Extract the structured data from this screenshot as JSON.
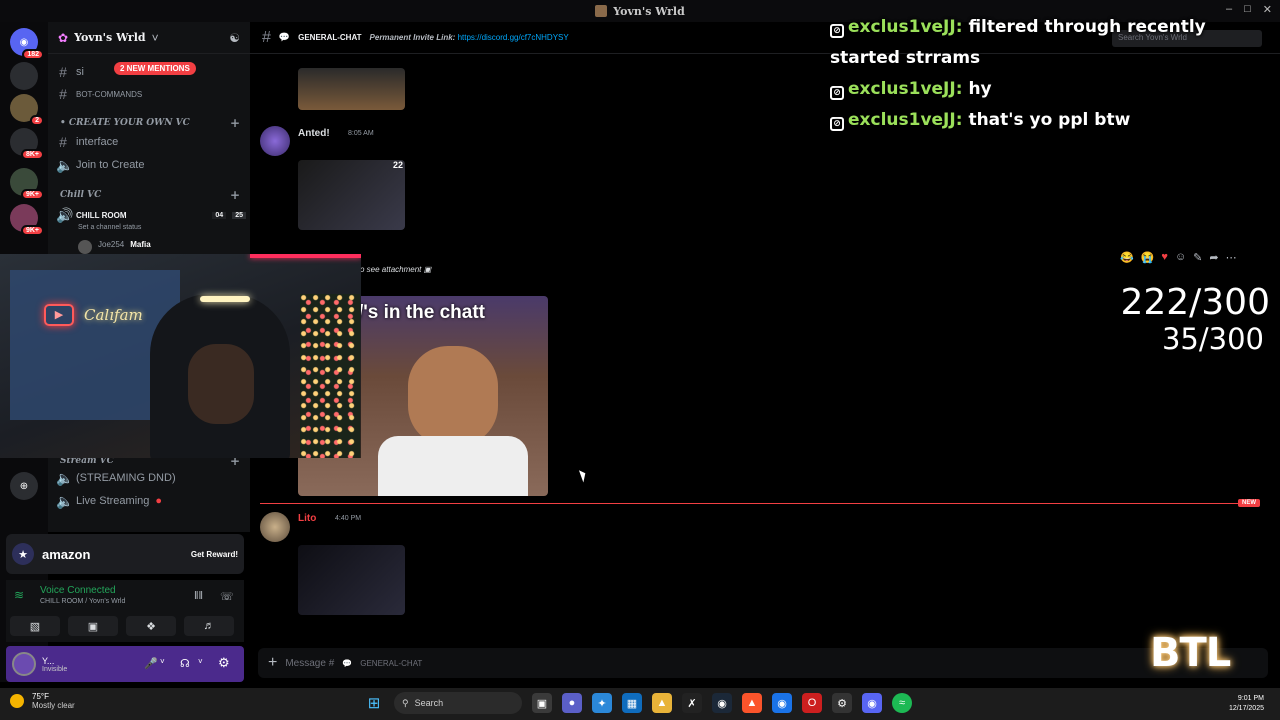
{
  "window": {
    "title": "Yovn's Wrld",
    "controls": [
      "–",
      "□",
      "✕"
    ]
  },
  "server_rail": {
    "badges": [
      "182",
      "2",
      "8K+",
      "9K+",
      "9K+"
    ]
  },
  "sidebar": {
    "server_name": "Yovn's Wrld",
    "mentions_pill": "2 NEW MENTIONS",
    "channels": [
      {
        "name": "si",
        "type": "text"
      },
      {
        "name": "BOT-COMMANDS",
        "type": "text"
      },
      {
        "name": "interface",
        "type": "text"
      },
      {
        "name": "Join to Create",
        "type": "voice"
      },
      {
        "name": "(STREAMING DND)",
        "type": "voice"
      },
      {
        "name": "Live Streaming",
        "type": "voice"
      }
    ],
    "categories": [
      "CREATE YOUR OWN VC",
      "Chill VC",
      "Stream VC"
    ],
    "chill_room": {
      "name": "CHILL ROOM",
      "counts": [
        "04",
        "25"
      ],
      "status": "Set a channel status"
    },
    "voice_member": {
      "name": "Joe254",
      "tag": "Mafia"
    }
  },
  "promo": {
    "brand": "amazon",
    "cta": "Get Reward!"
  },
  "voice": {
    "status": "Voice Connected",
    "location": "CHILL ROOM / Yovn's Wrld"
  },
  "user": {
    "name": "Y...",
    "status": "Invisible"
  },
  "chat": {
    "channel": "GENERAL-CHAT",
    "topic_label": "Permanent Invite Link:",
    "topic_link": "https://discord.gg/cf7cNHDYSY",
    "search_placeholder": "Search Yovn's Wrld",
    "messages": [
      {
        "author": "Anted!",
        "time": "8:05 AM",
        "author_color": "#dbdee1"
      },
      {
        "author": "Lito",
        "time": "4:40 PM",
        "author_color": "#f23f43"
      }
    ],
    "attachment_label": "o see attachment",
    "meme_caption": "/'s in the chatt",
    "thumb_number": "22",
    "new_label": "NEW",
    "composer_placeholder": "Message #",
    "composer_channel": "GENERAL-CHAT"
  },
  "stream_overlay": {
    "messages": [
      {
        "user": "exclus1veJJ:",
        "text": "filtered through recently started strrams"
      },
      {
        "user": "exclus1veJJ:",
        "text": "hy"
      },
      {
        "user": "exclus1veJJ:",
        "text": "that's yo ppl btw"
      }
    ],
    "counter_1": "222/300",
    "counter_2": "35/300",
    "logo": "BTL",
    "neon_sign": "Calıfam"
  },
  "taskbar": {
    "weather_temp": "75°F",
    "weather_desc": "Mostly clear",
    "search_label": "Search",
    "time": "9:01 PM",
    "date": "12/17/2025"
  },
  "colors": {
    "accent": "#5865f2",
    "green": "#23a55a",
    "red": "#f23f43",
    "overlay_user": "#9be05a"
  }
}
